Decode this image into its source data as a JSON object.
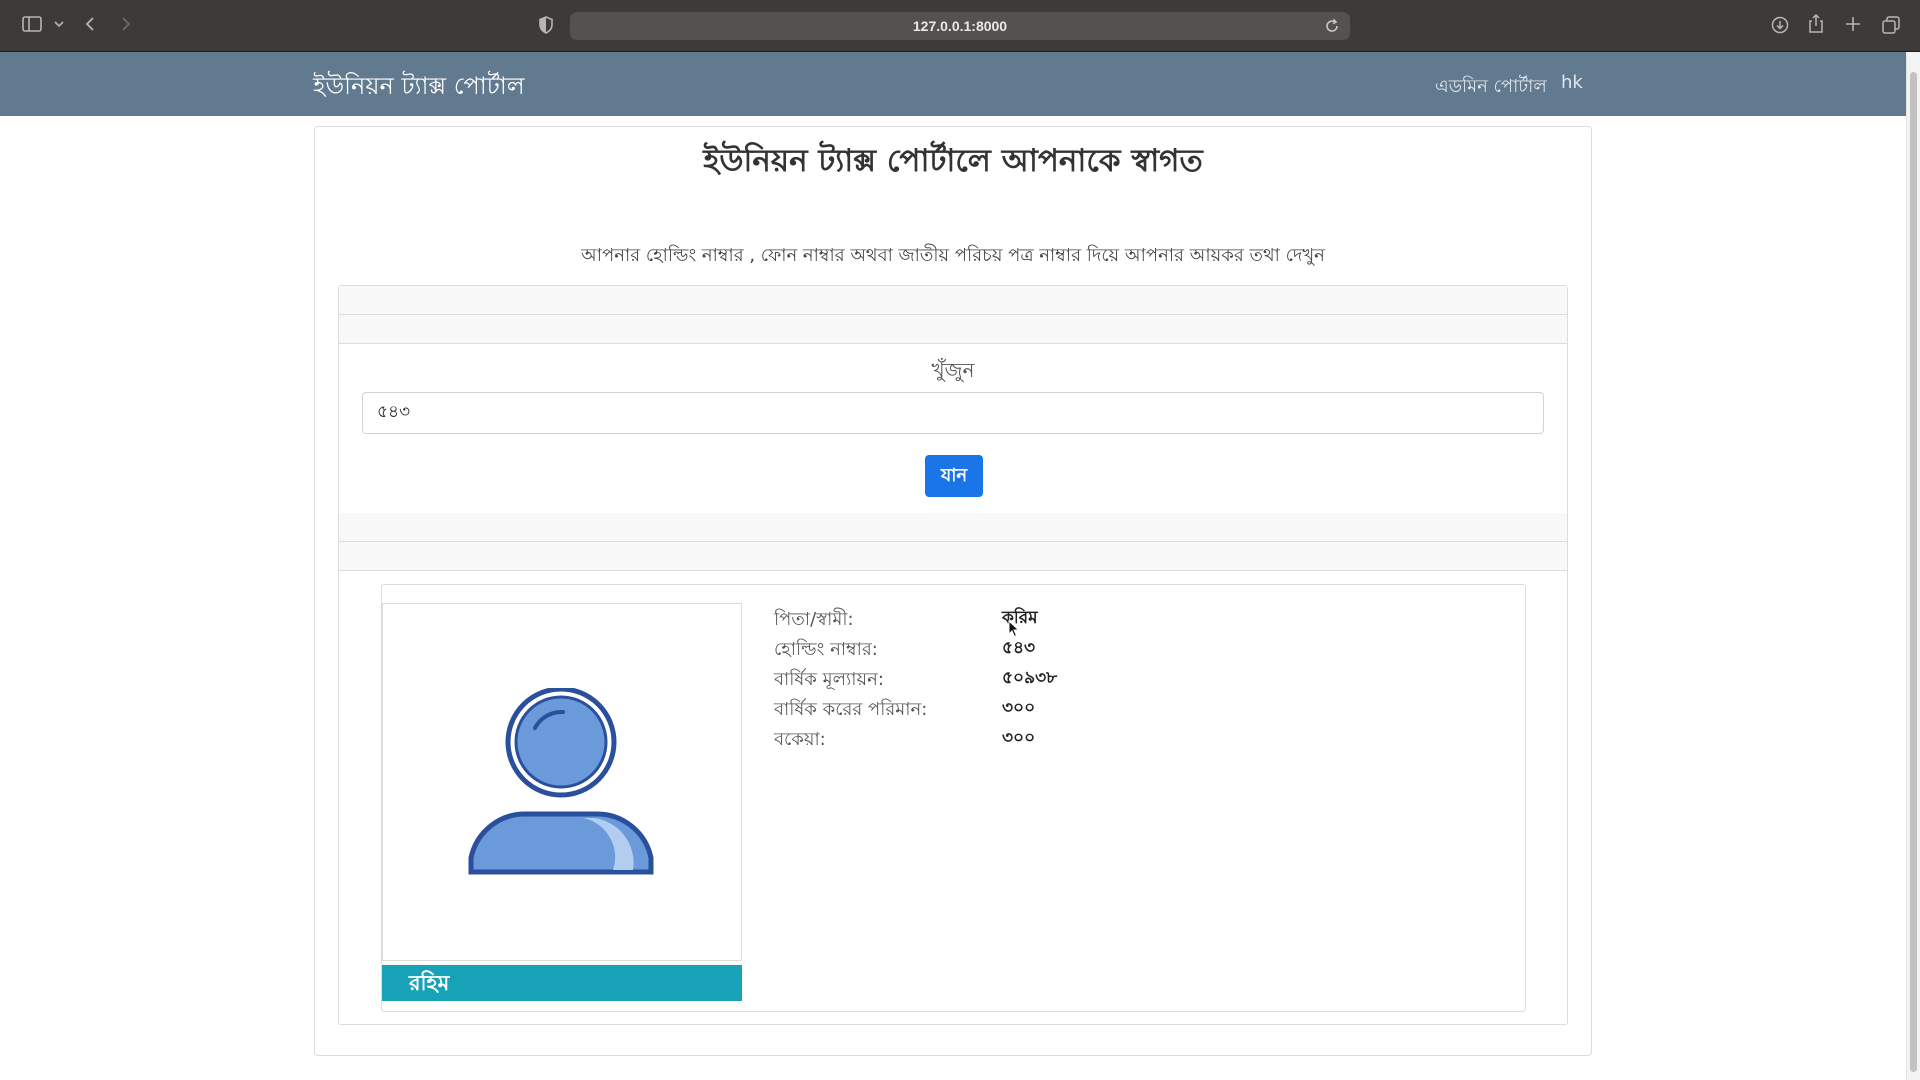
{
  "browser": {
    "url": "127.0.0.1:8000"
  },
  "nav": {
    "brand": "ইউনিয়ন ট্যাক্স পোর্টাল",
    "admin_link": "এডমিন পোর্টাল",
    "user_link": "hk"
  },
  "main": {
    "title": "ইউনিয়ন ট্যাক্স পোর্টালে আপনাকে স্বাগত",
    "instruction": "আপনার হোল্ডিং নাম্বার , ফোন নাম্বার অথবা জাতীয় পরিচয় পত্র নাম্বার দিয়ে আপনার আয়কর তথা দেখুন",
    "search_label": "খুঁজুন",
    "search_value": "৫৪৩",
    "go_button": "যান"
  },
  "profile": {
    "name": "রহিম",
    "fields": [
      {
        "label": "পিতা/স্বামী:",
        "value": "করিম"
      },
      {
        "label": "হোল্ডিং নাম্বার:",
        "value": "৫৪৩"
      },
      {
        "label": "বার্ষিক মূল্যায়ন:",
        "value": "৫০৯৩৮"
      },
      {
        "label": "বার্ষিক করের পরিমান:",
        "value": "৩০০"
      },
      {
        "label": "বকেয়া:",
        "value": "৩০০"
      }
    ]
  },
  "colors": {
    "navbar": "#617a8f",
    "button": "#1a76e8",
    "name_bar": "#17a2b8",
    "avatar_fill": "#6a9ad9",
    "avatar_stroke": "#2a4f9c"
  }
}
